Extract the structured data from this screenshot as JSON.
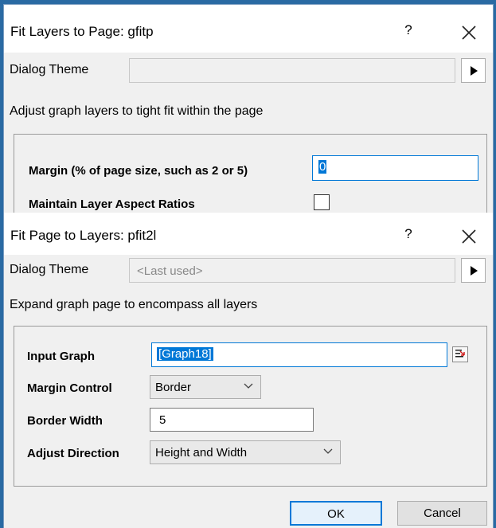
{
  "dialog1": {
    "title": "Fit Layers to Page: gfitp",
    "help": "?",
    "theme_label": "Dialog Theme",
    "theme_value": "",
    "description": "Adjust graph layers to tight fit within the page",
    "margin_label": "Margin (% of page size, such as 2 or 5)",
    "margin_value": "0",
    "aspect_label": "Maintain Layer Aspect Ratios",
    "aspect_checked": false
  },
  "dialog2": {
    "title": "Fit Page to Layers: pfit2l",
    "help": "?",
    "theme_label": "Dialog Theme",
    "theme_value": "<Last used>",
    "description": "Expand graph page to encompass all layers",
    "input_graph_label": "Input Graph",
    "input_graph_value": "[Graph18]",
    "margin_control_label": "Margin Control",
    "margin_control_value": "Border",
    "border_width_label": "Border Width",
    "border_width_value": "5",
    "adjust_direction_label": "Adjust Direction",
    "adjust_direction_value": "Height and Width",
    "ok_label": "OK",
    "cancel_label": "Cancel"
  },
  "icons": {
    "close": "close-icon",
    "theme_menu": "play-arrow-icon",
    "select_graph": "graph-picker-icon",
    "dropdown": "chevron-down-icon"
  },
  "colors": {
    "desktop_bg": "#2a6aa3",
    "selection": "#0078d7",
    "focus_border": "#0078d7"
  }
}
